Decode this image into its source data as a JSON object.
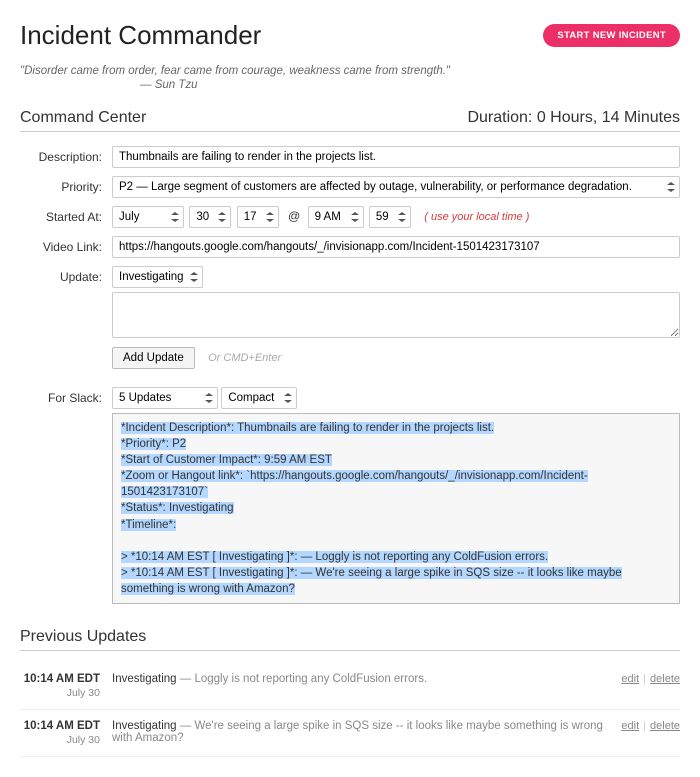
{
  "header": {
    "title": "Incident Commander",
    "start_btn": "START NEW INCIDENT",
    "quote": "\"Disorder came from order, fear came from courage, weakness came from strength.\"",
    "quote_attr": "— Sun Tzu"
  },
  "command_center": {
    "title": "Command Center",
    "duration_label": "Duration:",
    "duration_value": "0 Hours, 14 Minutes",
    "labels": {
      "description": "Description:",
      "priority": "Priority:",
      "started_at": "Started At:",
      "video_link": "Video Link:",
      "update": "Update:",
      "for_slack": "For Slack:"
    },
    "description_value": "Thumbnails are failing to render in the projects list.",
    "priority_value": "P2 — Large segment of customers are affected by outage, vulnerability, or performance degradation.",
    "started_at": {
      "month": "July",
      "day": "30",
      "year": "17",
      "at": "@",
      "hour": "9 AM",
      "minute": "59",
      "hint": "( use your local time )"
    },
    "video_link_value": "https://hangouts.google.com/hangouts/_/invisionapp.com/Incident-1501423173107",
    "update_status": "Investigating",
    "add_update_btn": "Add Update",
    "add_update_hint": "Or CMD+Enter",
    "slack_count": "5 Updates",
    "slack_format": "Compact",
    "slack_text_lines": [
      "*Incident Description*: Thumbnails are failing to render in the projects list.",
      "*Priority*: P2",
      "*Start of Customer Impact*: 9:59 AM EST",
      "*Zoom or Hangout link*: `https://hangouts.google.com/hangouts/_/invisionapp.com/Incident-1501423173107`",
      "*Status*: Investigating",
      "*Timeline*:",
      "",
      "> *10:14 AM EST [ Investigating ]*: — Loggly is not reporting any ColdFusion errors.",
      "> *10:14 AM EST [ Investigating ]*: — We're seeing a large spike in SQS size -- it looks like maybe something is wrong with Amazon?"
    ]
  },
  "previous_updates": {
    "title": "Previous Updates",
    "items": [
      {
        "time": "10:14 AM EDT",
        "date": "July 30",
        "status": "Investigating",
        "message": "— Loggly is not reporting any ColdFusion errors."
      },
      {
        "time": "10:14 AM EDT",
        "date": "July 30",
        "status": "Investigating",
        "message": "— We're seeing a large spike in SQS size -- it looks like maybe something is wrong with Amazon?"
      }
    ],
    "edit_label": "edit",
    "delete_label": "delete"
  }
}
